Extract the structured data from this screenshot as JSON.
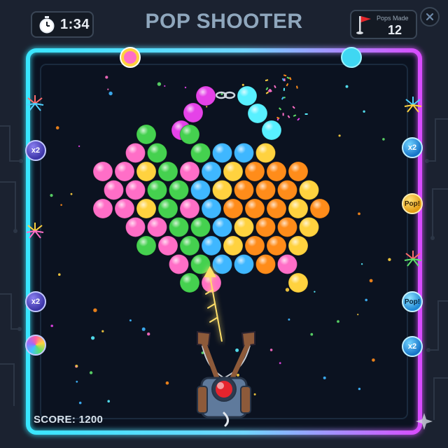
{
  "header": {
    "timer": "1:34",
    "title": "POP SHOOTER",
    "pops_made_label": "Pops Made",
    "pops_made_value": "12"
  },
  "score_text": "SCORE: 1200",
  "powerups": {
    "left": [
      {
        "kind": "x2",
        "label": "x2"
      },
      {
        "kind": "x2",
        "label": "x2"
      },
      {
        "kind": "rainbow",
        "label": ""
      }
    ],
    "right": [
      {
        "kind": "x2",
        "label": "x2"
      },
      {
        "kind": "pop",
        "label": "Pop!"
      },
      {
        "kind": "pop",
        "label": "Pop!"
      },
      {
        "kind": "x2",
        "label": "x2"
      }
    ]
  },
  "colors": {
    "frame_cyan": "#39e6ff",
    "frame_magenta": "#d94cff",
    "board_bg": "#0b1220",
    "pink": "#ff6ec7",
    "green": "#45d14f",
    "yellow": "#ffd23f",
    "blue": "#3fb7ff",
    "orange": "#ff8c1a",
    "magenta": "#e542e8",
    "cyan": "#58f0ff"
  },
  "bubble_grid": [
    "....g.g.....",
    "...pg.gbby..",
    "..ppygpbyooo",
    "..ppggbyoooy",
    "..ppygpboooyo",
    "...ppggbyooy",
    "....gpgbyooy",
    ".....pgbbop",
    "......gp...y"
  ],
  "chain_left": [
    "magenta",
    "magenta",
    "magenta"
  ],
  "chain_right": [
    "cyan",
    "cyan",
    "cyan",
    "cyan"
  ],
  "aim_direction": "up"
}
